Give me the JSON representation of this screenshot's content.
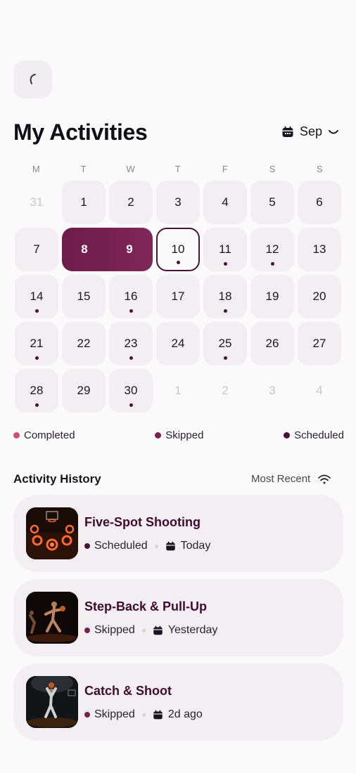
{
  "header": {
    "title": "My Activities",
    "month": "Sep"
  },
  "calendar": {
    "weekdays": [
      "M",
      "T",
      "W",
      "T",
      "F",
      "S",
      "S"
    ],
    "days": [
      {
        "label": "31",
        "muted": true,
        "dot": false
      },
      {
        "label": "1",
        "muted": false,
        "dot": false
      },
      {
        "label": "2",
        "muted": false,
        "dot": false
      },
      {
        "label": "3",
        "muted": false,
        "dot": false
      },
      {
        "label": "4",
        "muted": false,
        "dot": false
      },
      {
        "label": "5",
        "muted": false,
        "dot": false
      },
      {
        "label": "6",
        "muted": false,
        "dot": false
      },
      {
        "label": "7",
        "muted": false,
        "dot": false
      },
      {
        "label": "8",
        "muted": false,
        "dot": false,
        "selected": true
      },
      {
        "label": "9",
        "muted": false,
        "dot": false,
        "selected": true
      },
      {
        "label": "10",
        "muted": false,
        "dot": true,
        "today": true
      },
      {
        "label": "11",
        "muted": false,
        "dot": true
      },
      {
        "label": "12",
        "muted": false,
        "dot": true
      },
      {
        "label": "13",
        "muted": false,
        "dot": false
      },
      {
        "label": "14",
        "muted": false,
        "dot": true
      },
      {
        "label": "15",
        "muted": false,
        "dot": false
      },
      {
        "label": "16",
        "muted": false,
        "dot": true
      },
      {
        "label": "17",
        "muted": false,
        "dot": false
      },
      {
        "label": "18",
        "muted": false,
        "dot": true
      },
      {
        "label": "19",
        "muted": false,
        "dot": false
      },
      {
        "label": "20",
        "muted": false,
        "dot": false
      },
      {
        "label": "21",
        "muted": false,
        "dot": true
      },
      {
        "label": "22",
        "muted": false,
        "dot": false
      },
      {
        "label": "23",
        "muted": false,
        "dot": true
      },
      {
        "label": "24",
        "muted": false,
        "dot": false
      },
      {
        "label": "25",
        "muted": false,
        "dot": true
      },
      {
        "label": "26",
        "muted": false,
        "dot": false
      },
      {
        "label": "27",
        "muted": false,
        "dot": false
      },
      {
        "label": "28",
        "muted": false,
        "dot": true
      },
      {
        "label": "29",
        "muted": false,
        "dot": false
      },
      {
        "label": "30",
        "muted": false,
        "dot": true
      },
      {
        "label": "1",
        "muted": true,
        "dot": false
      },
      {
        "label": "2",
        "muted": true,
        "dot": false
      },
      {
        "label": "3",
        "muted": true,
        "dot": false
      },
      {
        "label": "4",
        "muted": true,
        "dot": false
      }
    ],
    "selected_range": [
      "8",
      "9"
    ]
  },
  "legend": [
    {
      "label": "Completed",
      "color": "#d14b76"
    },
    {
      "label": "Skipped",
      "color": "#7a1f4f"
    },
    {
      "label": "Scheduled",
      "color": "#4a1235"
    }
  ],
  "history": {
    "title": "Activity History",
    "sort_label": "Most Recent",
    "items": [
      {
        "name": "Five-Spot Shooting",
        "status": "Scheduled",
        "status_color": "#4a1235",
        "when": "Today"
      },
      {
        "name": "Step-Back & Pull-Up",
        "status": "Skipped",
        "status_color": "#7a1f4f",
        "when": "Yesterday"
      },
      {
        "name": "Catch & Shoot",
        "status": "Skipped",
        "status_color": "#7a1f4f",
        "when": "2d ago"
      }
    ]
  }
}
